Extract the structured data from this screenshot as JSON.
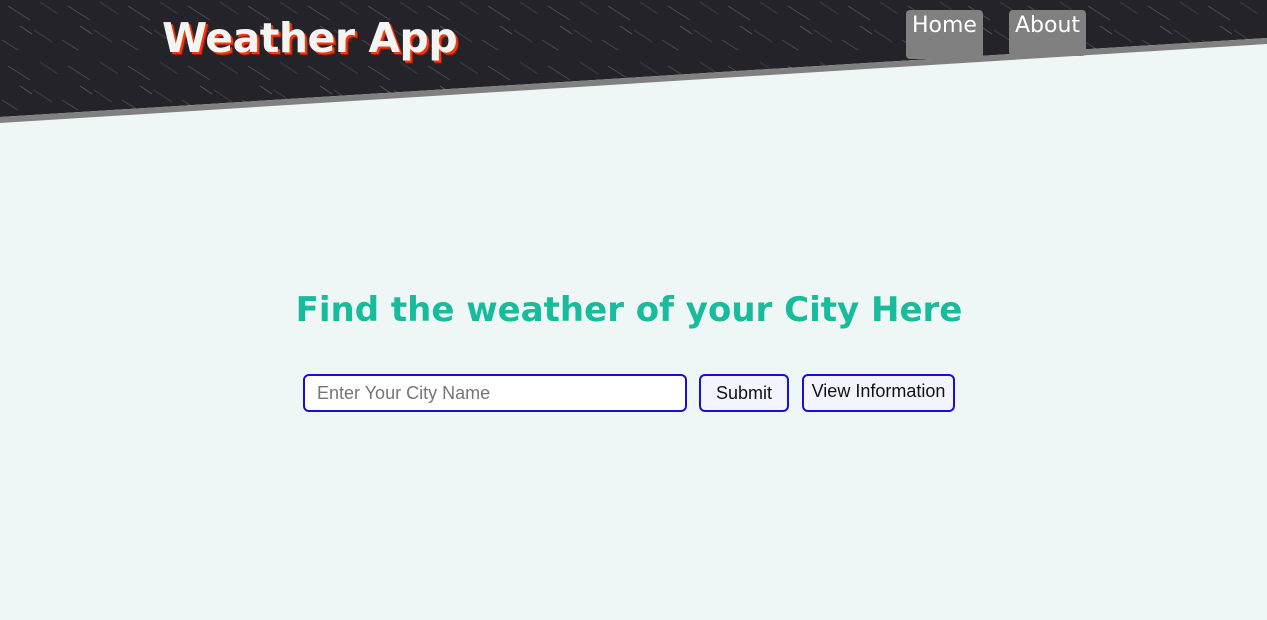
{
  "header": {
    "brand": "Weather App",
    "nav": [
      {
        "label": "Home"
      },
      {
        "label": "About"
      }
    ]
  },
  "main": {
    "title": "Find the weather of your City Here",
    "search": {
      "placeholder": "Enter Your City Name",
      "value": ""
    },
    "submit_label": "Submit",
    "view_label": "View Information"
  },
  "colors": {
    "page_background": "#eff7f6",
    "header_dark": "#232329",
    "header_edge": "#808080",
    "nav_button": "#808080",
    "title": "#18bc9c",
    "input_border": "#1a0ed6",
    "brand_shadow": "#e8400c"
  }
}
